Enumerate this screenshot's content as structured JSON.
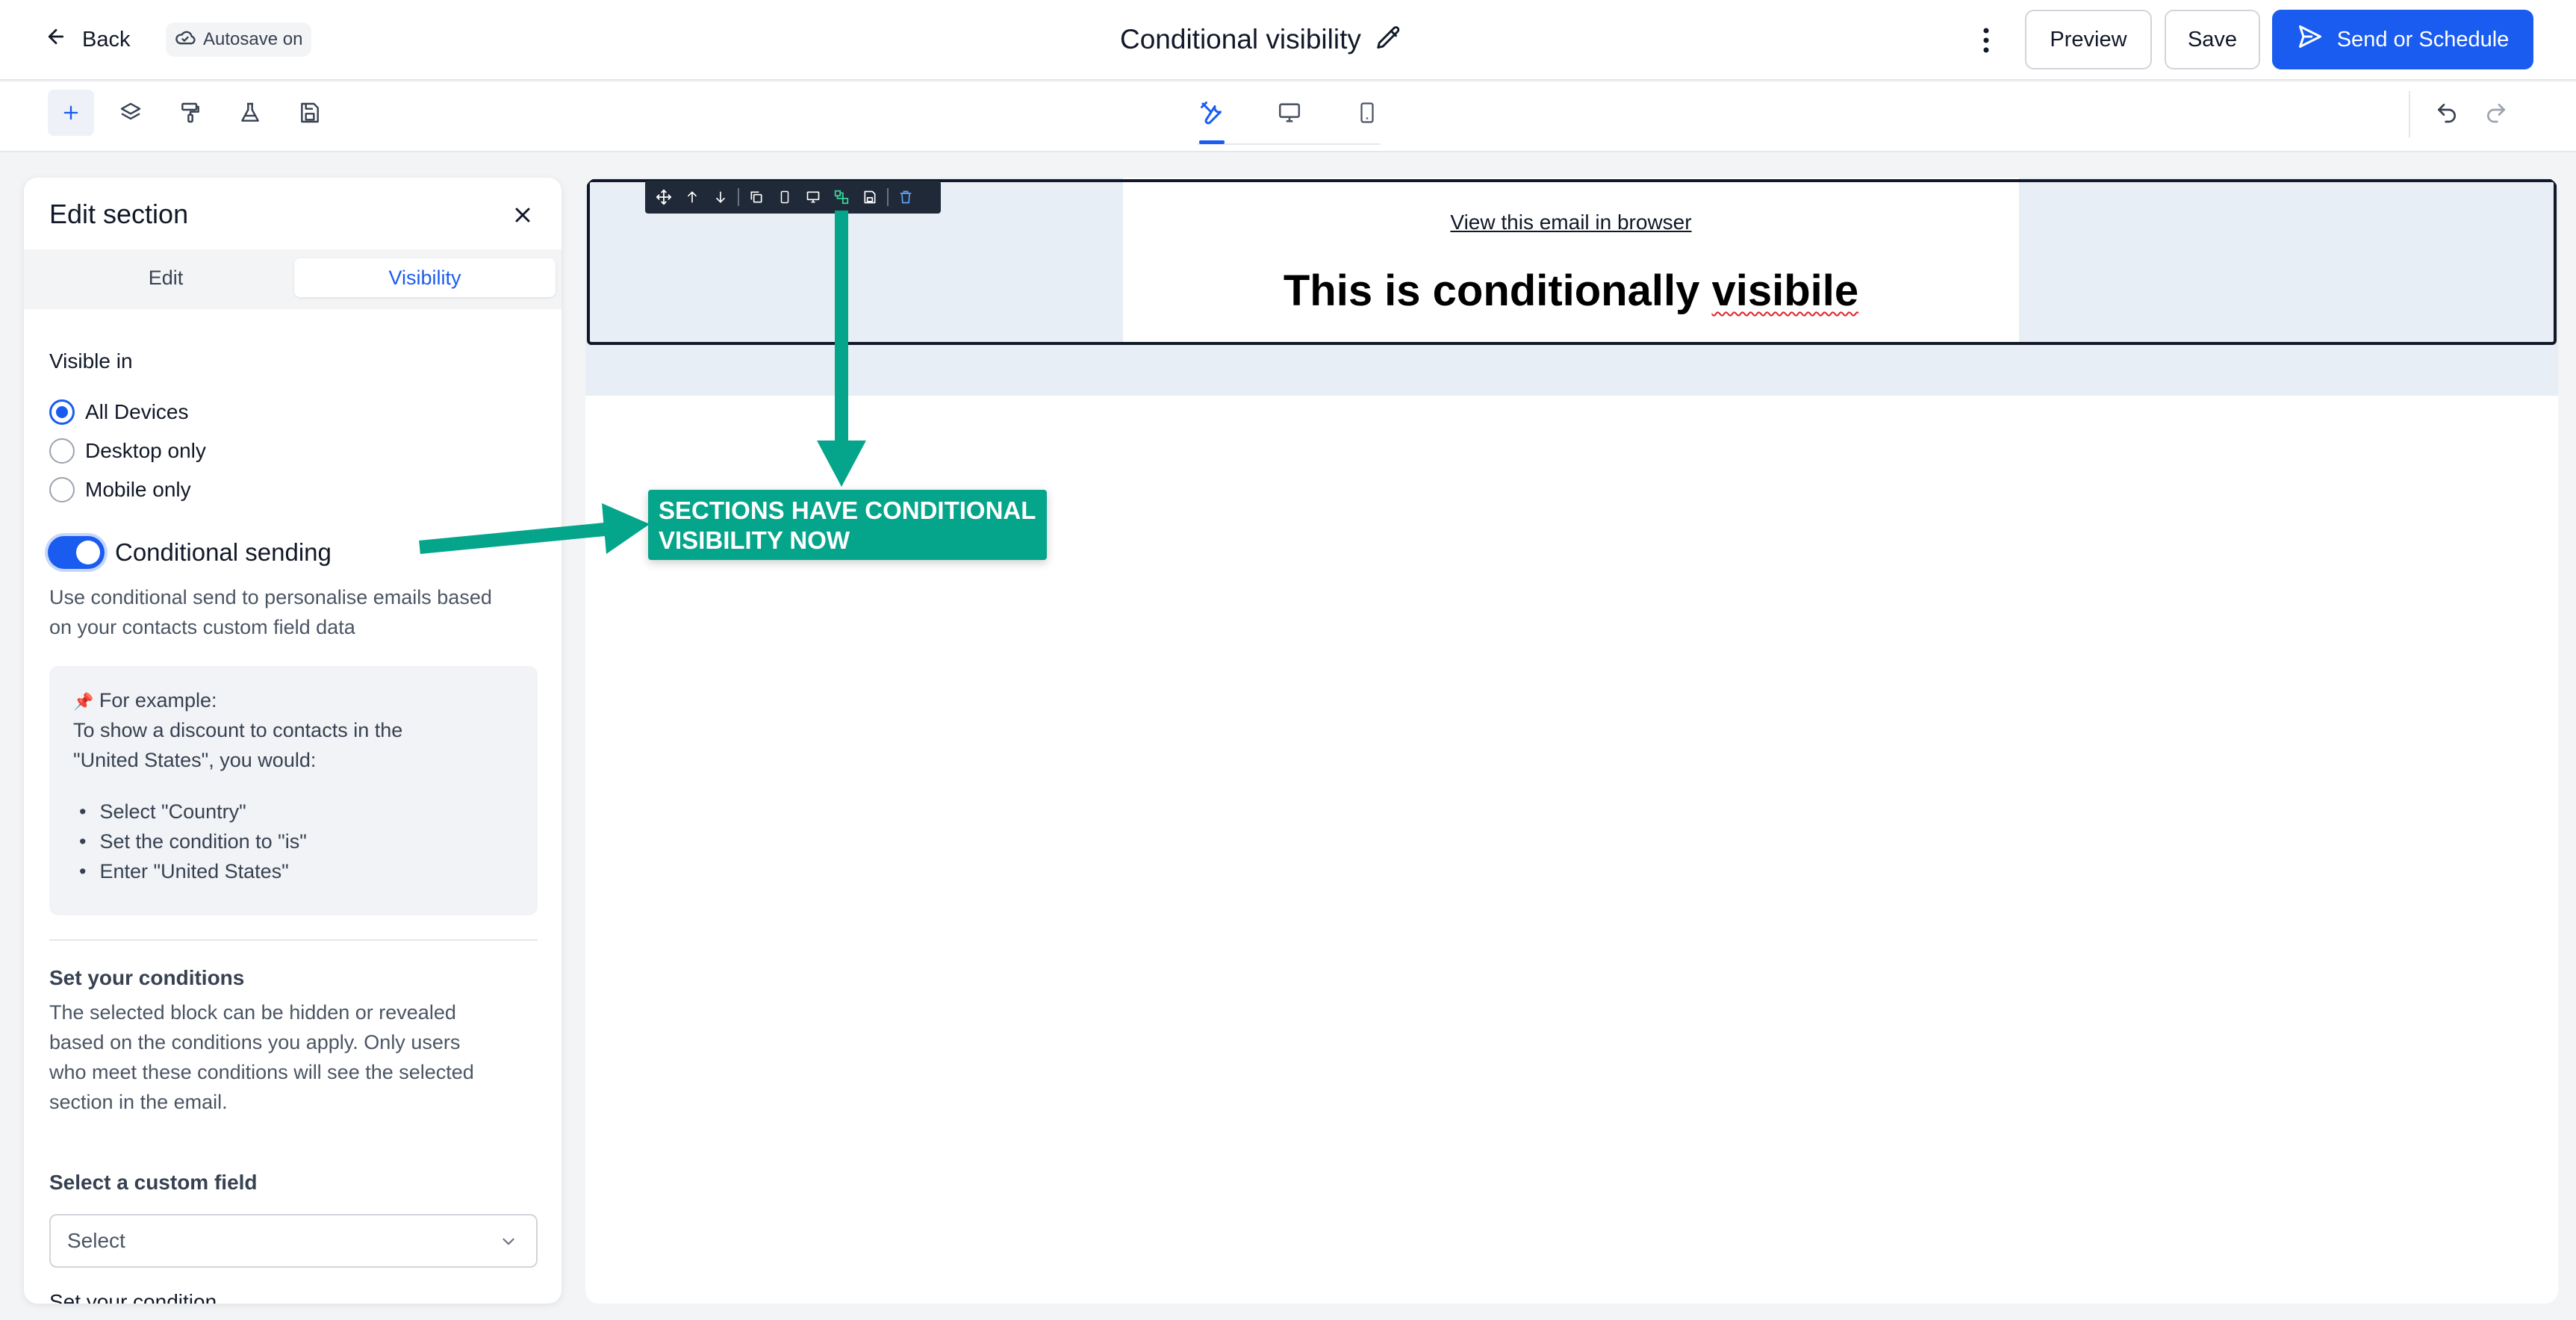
{
  "header": {
    "back_label": "Back",
    "autosave_label": "Autosave on",
    "title": "Conditional visibility",
    "preview_label": "Preview",
    "save_label": "Save",
    "send_label": "Send or Schedule"
  },
  "colors": {
    "accent": "#1a5cf0",
    "annotation": "#05a58b",
    "email_background": "#e8eef6"
  },
  "toolbar": {
    "left_tools": [
      "add-icon",
      "layers-icon",
      "paint-roller-icon",
      "flask-icon",
      "save-icon"
    ],
    "view_tabs": [
      "design-tools-icon",
      "desktop-icon",
      "mobile-icon"
    ],
    "history": [
      "undo-icon",
      "redo-icon"
    ]
  },
  "panel": {
    "title": "Edit section",
    "tabs": {
      "edit": "Edit",
      "visibility": "Visibility"
    },
    "visible_in_label": "Visible in",
    "options": [
      "All Devices",
      "Desktop only",
      "Mobile only"
    ],
    "selected_option": "All Devices",
    "conditional_label": "Conditional sending",
    "conditional_enabled": true,
    "conditional_desc_1": "Use conditional send to personalise emails based",
    "conditional_desc_2": "on your contacts custom field data",
    "example": {
      "pin": "📌",
      "heading": "For example:",
      "line_1": "To show a discount to contacts in the",
      "line_2": "\"United States\", you would:",
      "bullets": [
        "Select \"Country\"",
        "Set the condition to \"is\"",
        "Enter \"United States\""
      ]
    },
    "conditions_title": "Set your conditions",
    "conditions_desc": [
      "The selected block can be hidden or revealed",
      "based on the conditions you apply. Only users",
      "who meet these conditions will see the selected",
      "section in the email."
    ],
    "custom_field_label": "Select a custom field",
    "custom_field_placeholder": "Select",
    "next_label_partial": "Set your condition"
  },
  "email": {
    "view_in_browser": "View this email in browser",
    "headline_main": "This is conditionally ",
    "headline_flagged": "visibile"
  },
  "annotation": {
    "line_1": "SECTIONS HAVE CONDITIONAL",
    "line_2": "VISIBILITY NOW"
  }
}
